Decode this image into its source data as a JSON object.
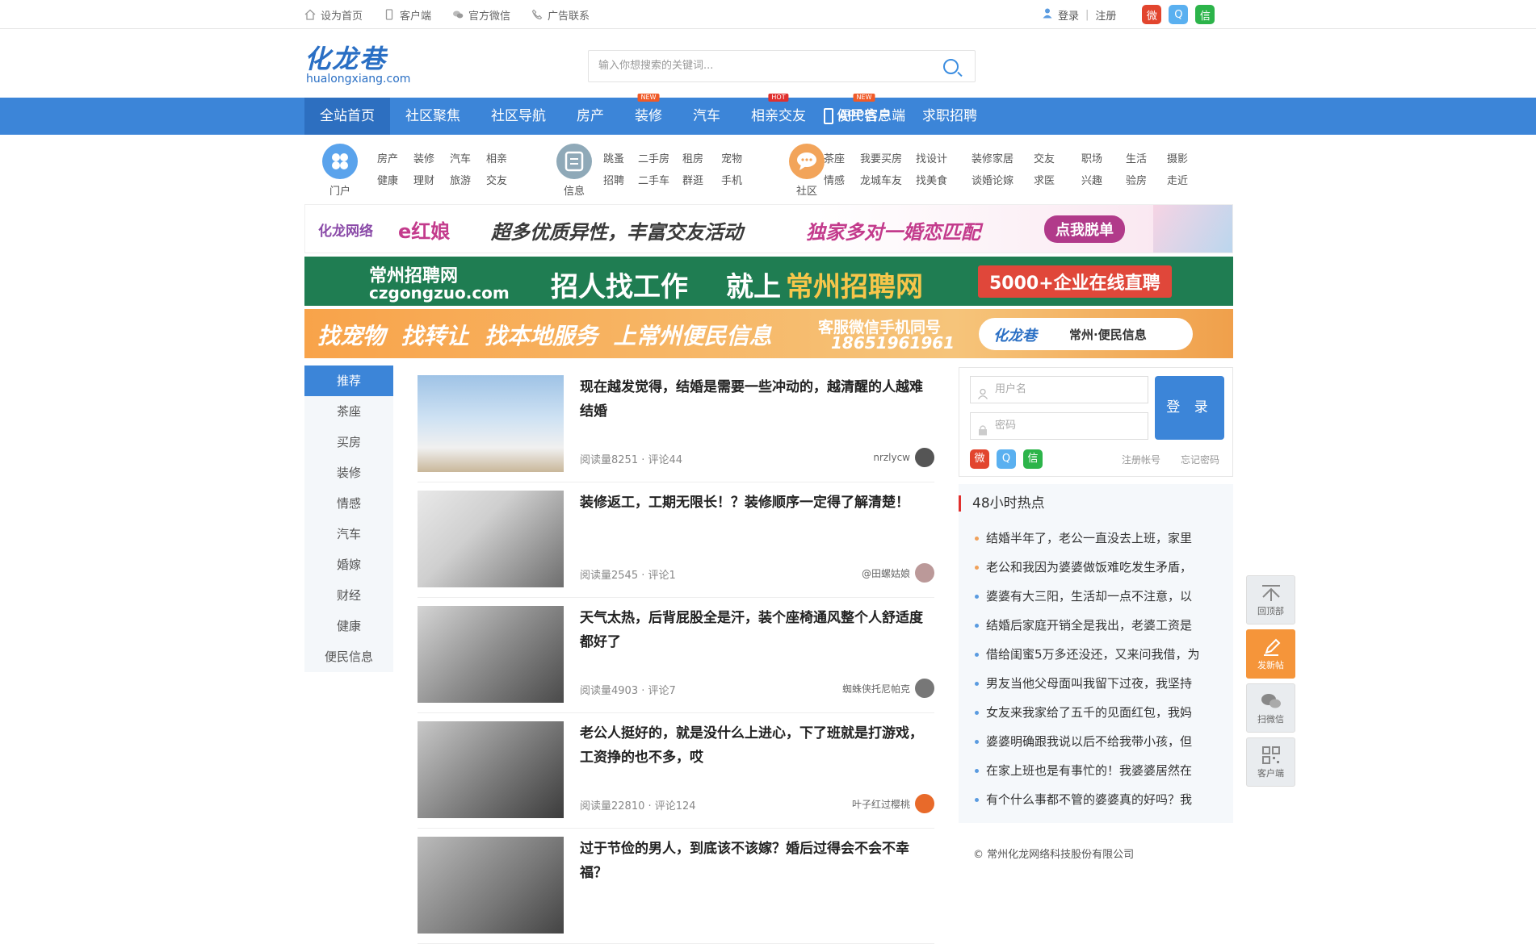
{
  "topbar": {
    "links": [
      "设为首页",
      "客户端",
      "官方微信",
      "广告联系"
    ],
    "login": "登录",
    "sep": "|",
    "register": "注册"
  },
  "logo": {
    "cn": "化龙巷",
    "en": "hualongxiang.com"
  },
  "search": {
    "placeholder": "输入你想搜索的关键词..."
  },
  "nav": {
    "items": [
      {
        "label": "全站首页",
        "tag": ""
      },
      {
        "label": "社区聚焦",
        "tag": ""
      },
      {
        "label": "社区导航",
        "tag": ""
      },
      {
        "label": "房产",
        "tag": ""
      },
      {
        "label": "装修",
        "tag": "NEW"
      },
      {
        "label": "汽车",
        "tag": ""
      },
      {
        "label": "相亲交友",
        "tag": "HOT"
      },
      {
        "label": "便民信息",
        "tag": "NEW"
      },
      {
        "label": "求职招聘",
        "tag": ""
      }
    ],
    "app": "APP客户端"
  },
  "subnav": {
    "portal": {
      "label": "门户",
      "row1": [
        "房产",
        "装修",
        "汽车",
        "相亲"
      ],
      "row2": [
        "健康",
        "理财",
        "旅游",
        "交友"
      ]
    },
    "info": {
      "label": "信息",
      "row1": [
        "跳蚤",
        "二手房",
        "租房",
        "宠物"
      ],
      "row2": [
        "招聘",
        "二手车",
        "群逛",
        "手机"
      ]
    },
    "community": {
      "label": "社区",
      "row1": [
        "茶座",
        "我要买房",
        "找设计",
        "装修家居",
        "交友",
        "职场",
        "生活",
        "摄影"
      ],
      "row2": [
        "情感",
        "龙城车友",
        "找美食",
        "谈婚论嫁",
        "求医",
        "兴趣",
        "验房",
        "走近"
      ]
    }
  },
  "banners": {
    "b1": {
      "brand": "化龙网络",
      "ehn": "e红娘",
      "slogan": "超多优质异性，丰富交友活动",
      "hl": "独家多对一婚恋匹配",
      "cta": "点我脱单"
    },
    "b2": {
      "site": "常州招聘网",
      "url": "czgongzuo.com",
      "slogan1": "招人找工作",
      "slogan2": "就上",
      "slogan3": "常州招聘网",
      "badge": "5000+企业在线直聘"
    },
    "b3": {
      "slogan": "找宠物  找转让  找本地服务  上常州便民信息",
      "contact1": "客服微信手机同号",
      "phone": "18651961961",
      "brand": "化龙巷",
      "tagline": "常州·便民信息"
    }
  },
  "leftmenu": [
    "推荐",
    "茶座",
    "买房",
    "装修",
    "情感",
    "汽车",
    "婚嫁",
    "财经",
    "健康",
    "便民信息"
  ],
  "posts": [
    {
      "title": "现在越发觉得，结婚是需要一些冲动的，越清醒的人越难结婚",
      "meta": "阅读量8251 · 评论44",
      "author": "nrzlycw",
      "av": "#555"
    },
    {
      "title": "装修返工，工期无限长！？装修顺序一定得了解清楚！",
      "meta": "阅读量2545 · 评论1",
      "author": "@田螺姑娘",
      "av": "#b99"
    },
    {
      "title": "天气太热，后背屁股全是汗，装个座椅通风整个人舒适度都好了",
      "meta": "阅读量4903 · 评论7",
      "author": "蜘蛛侠托尼帕克",
      "av": "#777"
    },
    {
      "title": "老公人挺好的，就是没什么上进心，下了班就是打游戏，工资挣的也不多，哎",
      "meta": "阅读量22810 · 评论124",
      "author": "叶子红过樱桃",
      "av": "#e86a2a"
    },
    {
      "title": "过于节俭的男人，到底该不该嫁？婚后过得会不会不幸福？",
      "meta": "",
      "author": "",
      "av": "#888"
    }
  ],
  "login": {
    "user_ph": "用户名",
    "pass_ph": "密码",
    "button": "登 录",
    "register": "注册帐号",
    "forgot": "忘记密码"
  },
  "hot": {
    "heading": "48小时热点",
    "items": [
      "结婚半年了，老公一直没去上班，家里",
      "老公和我因为婆婆做饭难吃发生矛盾，",
      "婆婆有大三阳，生活却一点不注意，以",
      "结婚后家庭开销全是我出，老婆工资是",
      "借给闺蜜5万多还没还，又来问我借，为",
      "男友当他父母面叫我留下过夜，我坚持",
      "女友来我家给了五千的见面红包，我妈",
      "婆婆明确跟我说以后不给我带小孩，但",
      "在家上班也是有事忙的！我婆婆居然在",
      "有个什么事都不管的婆婆真的好吗？我"
    ]
  },
  "footer": {
    "copyright": "© 常州化龙网络科技股份有限公司"
  },
  "float": {
    "top": "回顶部",
    "post": "发新帖",
    "wechat": "扫微信",
    "client": "客户端"
  },
  "colors": {
    "brand": "#3c85d8",
    "nav_active": "#2d6fc0",
    "hot_accent": "#e0302e",
    "orange": "#f5953a",
    "weibo": "#e2452e",
    "qq": "#5ab0f0",
    "wechat": "#2cb44a"
  }
}
